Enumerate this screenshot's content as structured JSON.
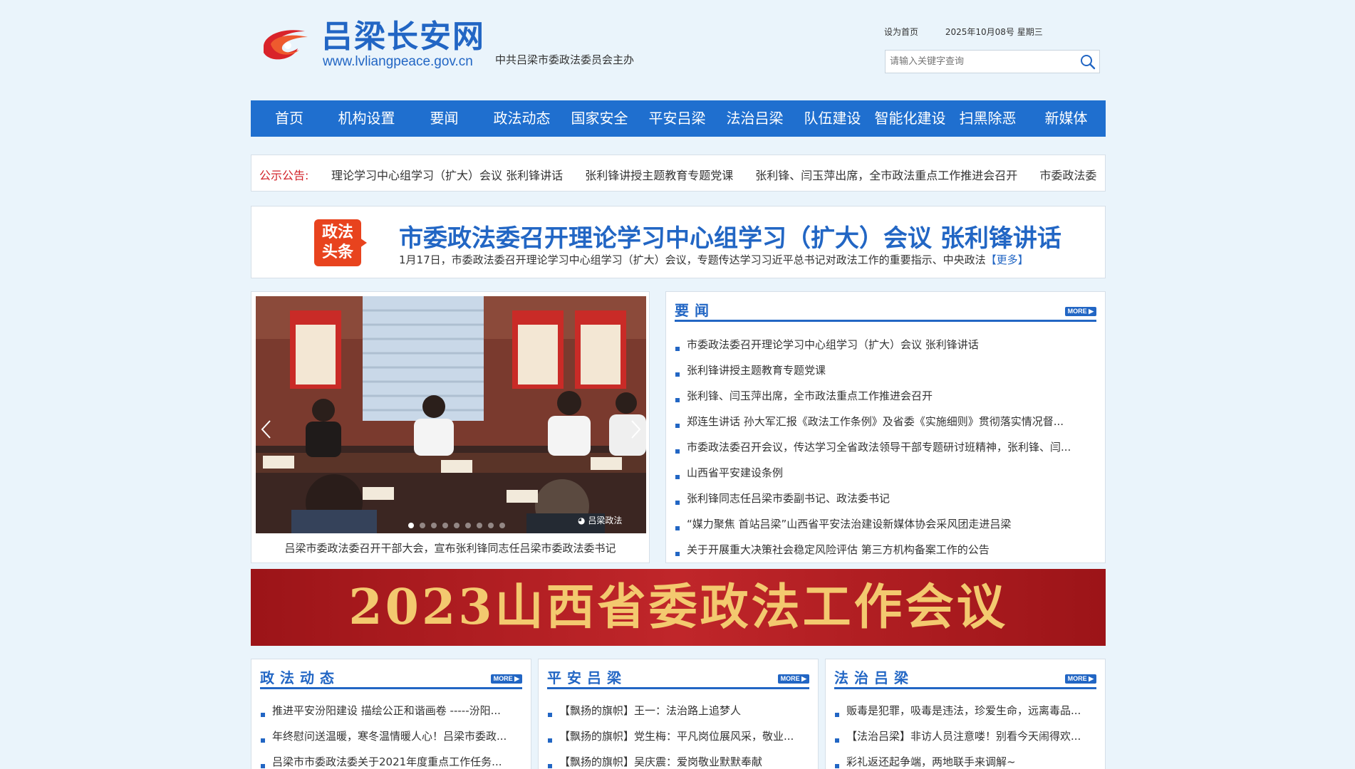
{
  "header": {
    "site_name": "吕梁长安网",
    "site_url": "www.lvliangpeace.gov.cn",
    "sponsor": "中共吕梁市委政法委员会主办",
    "set_homepage": "设为首页",
    "date": "2025年10月08号 星期三",
    "search_placeholder": "请输入关键字查询"
  },
  "nav": [
    "首页",
    "机构设置",
    "要闻",
    "政法动态",
    "国家安全",
    "平安吕梁",
    "法治吕梁",
    "队伍建设",
    "智能化建设",
    "扫黑除恶",
    "新媒体"
  ],
  "notice": {
    "label": "公示公告:",
    "items": [
      "理论学习中心组学习（扩大）会议 张利锋讲话",
      "张利锋讲授主题教育专题党课",
      "张利锋、闫玉萍出席，全市政法重点工作推进会召开",
      "市委政法委"
    ]
  },
  "headline": {
    "badge_line1": "政法",
    "badge_line2": "头条",
    "title": "市委政法委召开理论学习中心组学习（扩大）会议 张利锋讲话",
    "summary": "1月17日，市委政法委召开理论学习中心组学习（扩大）会议，专题传达学习习近平总书记对政法工作的重要指示、中央政法",
    "more": "【更多】"
  },
  "slider": {
    "caption": "吕梁市委政法委召开干部大会，宣布张利锋同志任吕梁市委政法委书记",
    "watermark": "吕梁政法",
    "dots": 9,
    "active_dot": 1
  },
  "yaowen": {
    "title": "要闻",
    "more": "MORE",
    "items": [
      "市委政法委召开理论学习中心组学习（扩大）会议 张利锋讲话",
      "张利锋讲授主题教育专题党课",
      "张利锋、闫玉萍出席，全市政法重点工作推进会召开",
      "郑连生讲话 孙大军汇报《政法工作条例》及省委《实施细则》贯彻落实情况督...",
      "市委政法委召开会议，传达学习全省政法领导干部专题研讨班精神，张利锋、闫...",
      "山西省平安建设条例",
      "张利锋同志任吕梁市委副书记、政法委书记",
      "“媒力聚焦 首站吕梁”山西省平安法治建设新媒体协会采风团走进吕梁",
      "关于开展重大决策社会稳定风险评估 第三方机构备案工作的公告"
    ]
  },
  "banner": {
    "text": "2023山西省委政法工作会议"
  },
  "zhengfa": {
    "title": "政法动态",
    "more": "MORE",
    "items": [
      "推进平安汾阳建设 描绘公正和谐画卷 -----汾阳...",
      "年终慰问送温暖，寒冬温情暖人心！吕梁市委政...",
      "吕梁市市委政法委关于2021年度重点工作任务..."
    ]
  },
  "pingan": {
    "title": "平安吕梁",
    "more": "MORE",
    "items": [
      "【飘扬的旗帜】王一：法治路上追梦人",
      "【飘扬的旗帜】党生梅：平凡岗位展风采，敬业...",
      "【飘扬的旗帜】吴庆震：爱岗敬业默默奉献"
    ]
  },
  "fazhi": {
    "title": "法治吕梁",
    "more": "MORE",
    "items": [
      "贩毒是犯罪，吸毒是违法，珍爱生命，远离毒品...",
      "【法治吕梁】非访人员注意喽！别看今天闹得欢...",
      "彩礼返还起争端，两地联手来调解~"
    ]
  },
  "colors": {
    "primary_blue": "#1f6fcf",
    "title_blue": "#2266c4",
    "notice_red": "#d2232a",
    "badge_orange": "#e8431e",
    "banner_red": "#b01c20",
    "banner_gold": "#f3c96f",
    "page_bg": "#eaf4fb"
  },
  "icons": {
    "logo": "swirl-logo",
    "search": "search-icon",
    "slider_prev": "chevron-left-icon",
    "slider_next": "chevron-right-icon",
    "watermark": "wechat-icon"
  }
}
